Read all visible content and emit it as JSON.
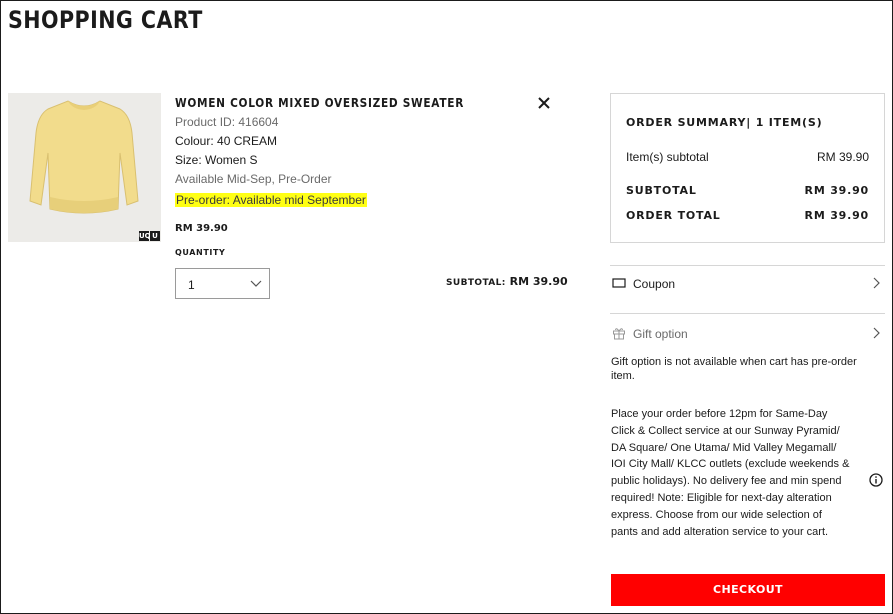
{
  "page": {
    "title": "SHOPPING CART"
  },
  "item": {
    "name": "WOMEN COLOR MIXED OVERSIZED SWEATER",
    "product_id": "Product ID: 416604",
    "colour": "Colour: 40 CREAM",
    "size": "Size: Women S",
    "availability": "Available Mid-Sep, Pre-Order",
    "preorder_note": "Pre-order: Available mid September",
    "price": "RM 39.90",
    "quantity_label": "QUANTITY",
    "quantity_value": "1",
    "subtotal_label": "SUBTOTAL:",
    "subtotal_value": "RM 39.90",
    "image_icon": "cream-sweater-image",
    "brand_logo_letters": [
      "UQ",
      "U"
    ]
  },
  "summary": {
    "title": "ORDER SUMMARY| 1 ITEM(S)",
    "items_subtotal_label": "Item(s) subtotal",
    "items_subtotal_value": "RM 39.90",
    "subtotal_label": "SUBTOTAL",
    "subtotal_value": "RM 39.90",
    "total_label": "ORDER TOTAL",
    "total_value": "RM 39.90"
  },
  "options": {
    "coupon_label": "Coupon",
    "gift_label": "Gift option",
    "gift_note": "Gift option is not available when cart has pre-order item."
  },
  "info": {
    "text": "Place your order before 12pm for Same-Day Click & Collect service at our Sunway Pyramid/ DA Square/ One Utama/ Mid Valley Megamall/ IOI City Mall/ KLCC outlets (exclude weekends & public holidays). No delivery fee and min spend required! Note: Eligible for next-day alteration express. Choose from our wide selection of pants and add alteration service to your cart."
  },
  "checkout": {
    "label": "CHECKOUT"
  },
  "colors": {
    "checkout": "#ff0000",
    "highlight": "#ffff14",
    "text": "#1b1b1b",
    "muted": "#6a6a6a",
    "border": "#d6d6d6"
  }
}
